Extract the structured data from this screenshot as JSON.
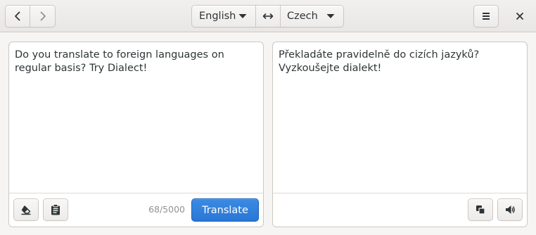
{
  "header": {
    "source_language": "English",
    "target_language": "Czech"
  },
  "source": {
    "text": "Do you translate to foreign languages on regular basis? Try Dialect!",
    "char_count": "68/5000",
    "translate_label": "Translate"
  },
  "target": {
    "text": "Překladáte pravidelně do cizích jazyků? Vyzkoušejte dialekt!"
  },
  "colors": {
    "accent": "#3584e4",
    "window_bg": "#f6f5f4",
    "text": "#2e3436"
  },
  "icons": {
    "back": "go-previous-icon",
    "forward": "go-next-icon",
    "dropdown": "pan-down-icon",
    "swap": "swap-arrows-icon",
    "menu": "hamburger-menu-icon",
    "close": "window-close-icon",
    "clear": "eraser-icon",
    "paste": "clipboard-icon",
    "copy": "copy-icon",
    "speak": "speaker-icon"
  }
}
